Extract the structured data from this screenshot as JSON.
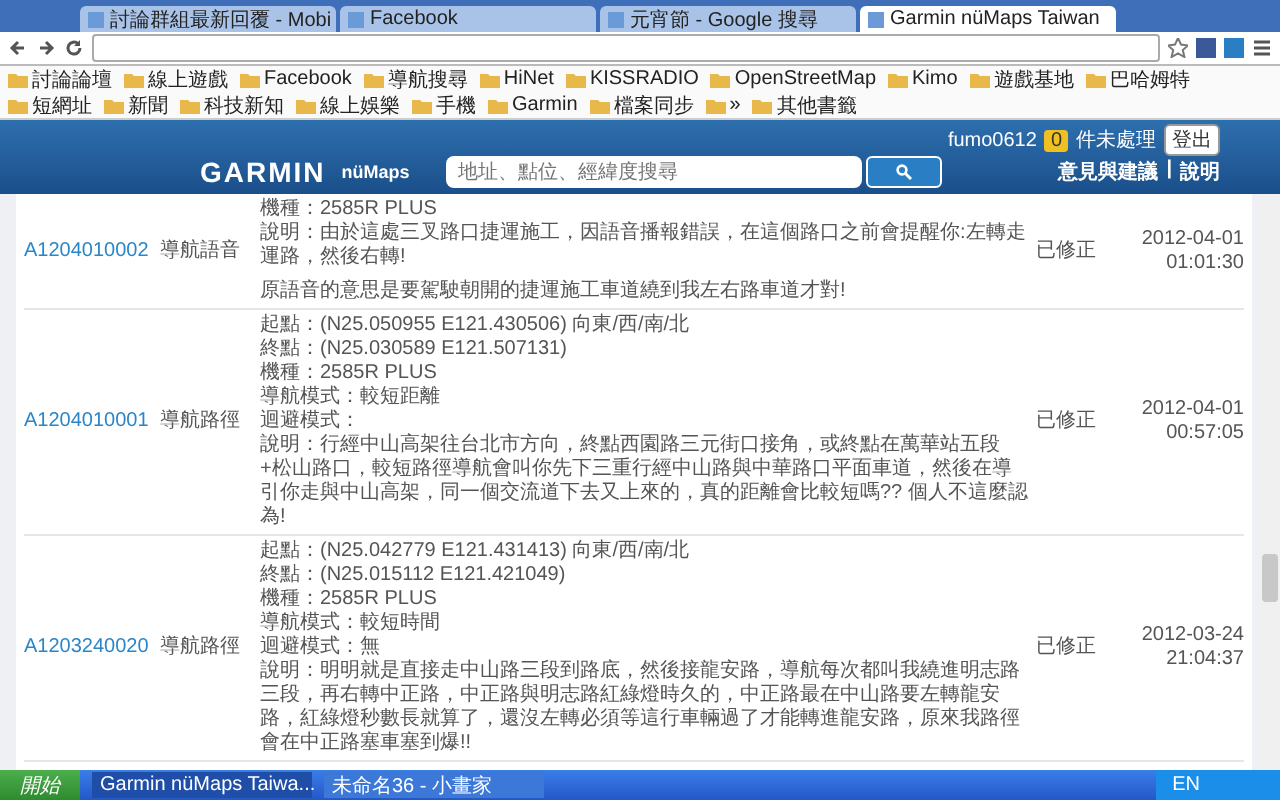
{
  "browser": {
    "tabs": [
      {
        "title": "討論群組最新回覆 - Mobi",
        "selected": false
      },
      {
        "title": "Facebook",
        "selected": false
      },
      {
        "title": "元宵節 - Google 搜尋",
        "selected": false
      },
      {
        "title": "Garmin nüMaps Taiwan",
        "selected": true
      }
    ],
    "bookmarks": [
      "討論論壇",
      "線上遊戲",
      "Facebook",
      "導航搜尋",
      "HiNet",
      "KISSRADIO",
      "OpenStreetMap",
      "Kimo",
      "遊戲基地",
      "巴哈姆特",
      "短網址",
      "新聞",
      "科技新知",
      "線上娛樂",
      "手機",
      "Garmin",
      "檔案同步",
      "»",
      "其他書籤"
    ]
  },
  "header": {
    "username": "fumo0612",
    "pending_count": "0",
    "pending_label": "件未處理",
    "logout": "登出",
    "logo": "GARMIN",
    "product": "nüMaps",
    "search": {
      "placeholder": "地址、點位、經緯度搜尋"
    },
    "links": [
      "意見與建議",
      "說明"
    ],
    "link_separator": "|"
  },
  "reports": [
    {
      "id": "A1204010002",
      "type": "導航語音",
      "description": [
        [
          "機種：2585R PLUS",
          "說明：由於這處三叉路口捷運施工，因語音播報錯誤，在這個路口之前會提醒你:左轉走運路，然後右轉!"
        ],
        [
          "原語音的意思是要駕駛朝開的捷運施工車道繞到我左右路車道才對!"
        ]
      ],
      "status": "已修正",
      "date": "2012-04-01",
      "time": "01:01:30"
    },
    {
      "id": "A1204010001",
      "type": "導航路徑",
      "description": [
        [
          "起點：(N25.050955 E121.430506) 向東/西/南/北",
          "終點：(N25.030589 E121.507131)",
          "機種：2585R PLUS",
          "導航模式：較短距離",
          "迴避模式：",
          "說明：行經中山高架往台北市方向，終點西園路三元街口接角，或終點在萬華站五段+松山路口，較短路徑導航會叫你先下三重行經中山路與中華路口平面車道，然後在導引你走與中山高架，同一個交流道下去又上來的，真的距離會比較短嗎?? 個人不這麼認為!"
        ]
      ],
      "status": "已修正",
      "date": "2012-04-01",
      "time": "00:57:05"
    },
    {
      "id": "A1203240020",
      "type": "導航路徑",
      "description": [
        [
          "起點：(N25.042779 E121.431413) 向東/西/南/北",
          "終點：(N25.015112 E121.421049)",
          "機種：2585R PLUS",
          "導航模式：較短時間",
          "迴避模式：無",
          "說明：明明就是直接走中山路三段到路底，然後接龍安路，導航每次都叫我繞進明志路三段，再右轉中正路，中正路與明志路紅綠燈時久的，中正路最在中山路要左轉龍安路，紅綠燈秒數長就算了，還沒左轉必須等這行車輛過了才能轉進龍安路，原來我路徑會在中正路塞車塞到爆!!"
        ]
      ],
      "status": "已修正",
      "date": "2012-03-24",
      "time": "21:04:37"
    }
  ],
  "taskbar": {
    "start": "開始",
    "windows": [
      {
        "title": "Garmin nüMaps Taiwa...",
        "selected": true
      },
      {
        "title": "未命名36 - 小畫家",
        "selected": false
      }
    ],
    "tray": "EN"
  }
}
